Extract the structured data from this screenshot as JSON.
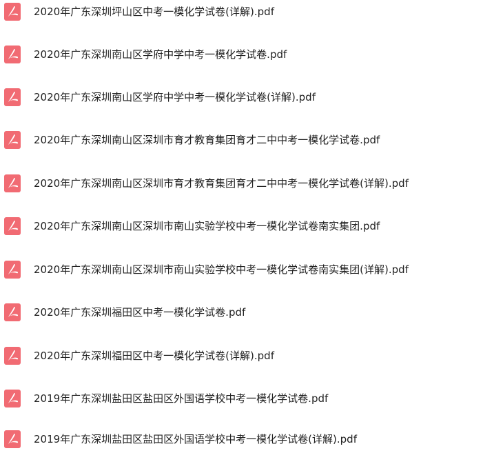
{
  "colors": {
    "icon_bg": "#f16b73",
    "icon_glyph": "#ffffff",
    "text": "#222222"
  },
  "files": [
    {
      "name": "2020年广东深圳坪山区中考一模化学试卷(详解).pdf",
      "icon": "pdf-icon"
    },
    {
      "name": "2020年广东深圳南山区学府中学中考一模化学试卷.pdf",
      "icon": "pdf-icon"
    },
    {
      "name": "2020年广东深圳南山区学府中学中考一模化学试卷(详解).pdf",
      "icon": "pdf-icon"
    },
    {
      "name": "2020年广东深圳南山区深圳市育才教育集团育才二中中考一模化学试卷.pdf",
      "icon": "pdf-icon"
    },
    {
      "name": "2020年广东深圳南山区深圳市育才教育集团育才二中中考一模化学试卷(详解).pdf",
      "icon": "pdf-icon"
    },
    {
      "name": "2020年广东深圳南山区深圳市南山实验学校中考一模化学试卷南实集团.pdf",
      "icon": "pdf-icon"
    },
    {
      "name": "2020年广东深圳南山区深圳市南山实验学校中考一模化学试卷南实集团(详解).pdf",
      "icon": "pdf-icon"
    },
    {
      "name": "2020年广东深圳福田区中考一模化学试卷.pdf",
      "icon": "pdf-icon"
    },
    {
      "name": "2020年广东深圳福田区中考一模化学试卷(详解).pdf",
      "icon": "pdf-icon"
    },
    {
      "name": "2019年广东深圳盐田区盐田区外国语学校中考一模化学试卷.pdf",
      "icon": "pdf-icon"
    },
    {
      "name": "2019年广东深圳盐田区盐田区外国语学校中考一模化学试卷(详解).pdf",
      "icon": "pdf-icon"
    }
  ]
}
